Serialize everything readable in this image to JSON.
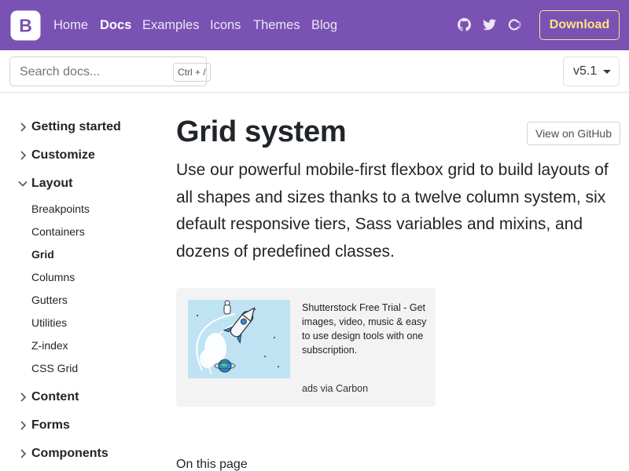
{
  "navbar": {
    "brand_letter": "B",
    "links": [
      {
        "label": "Home"
      },
      {
        "label": "Docs",
        "active": true
      },
      {
        "label": "Examples"
      },
      {
        "label": "Icons"
      },
      {
        "label": "Themes"
      },
      {
        "label": "Blog"
      }
    ],
    "icons": [
      "github-icon",
      "twitter-icon",
      "opencollective-icon"
    ],
    "download_label": "Download",
    "colors": {
      "background": "#7952b3",
      "download_accent": "#ffe484"
    }
  },
  "search": {
    "placeholder": "Search docs...",
    "shortcut": "Ctrl + /"
  },
  "version": {
    "selected": "v5.1"
  },
  "sidebar": {
    "groups": [
      {
        "label": "Getting started",
        "expanded": false
      },
      {
        "label": "Customize",
        "expanded": false
      },
      {
        "label": "Layout",
        "expanded": true,
        "items": [
          {
            "label": "Breakpoints"
          },
          {
            "label": "Containers"
          },
          {
            "label": "Grid",
            "current": true
          },
          {
            "label": "Columns"
          },
          {
            "label": "Gutters"
          },
          {
            "label": "Utilities"
          },
          {
            "label": "Z-index"
          },
          {
            "label": "CSS Grid"
          }
        ]
      },
      {
        "label": "Content",
        "expanded": false
      },
      {
        "label": "Forms",
        "expanded": false
      },
      {
        "label": "Components",
        "expanded": false
      }
    ]
  },
  "main": {
    "title": "Grid system",
    "github_button": "View on GitHub",
    "lead": "Use our powerful mobile-first flexbox grid to build layouts of all shapes and sizes thanks to a twelve column system, six default responsive tiers, Sass variables and mixins, and dozens of predefined classes.",
    "ad": {
      "text": "Shutterstock Free Trial - Get images, video, music & easy to use design tools with one subscription.",
      "powered_by": "ads via Carbon",
      "image_icon": "rocket-illustration"
    },
    "on_this_page": "On this page"
  }
}
